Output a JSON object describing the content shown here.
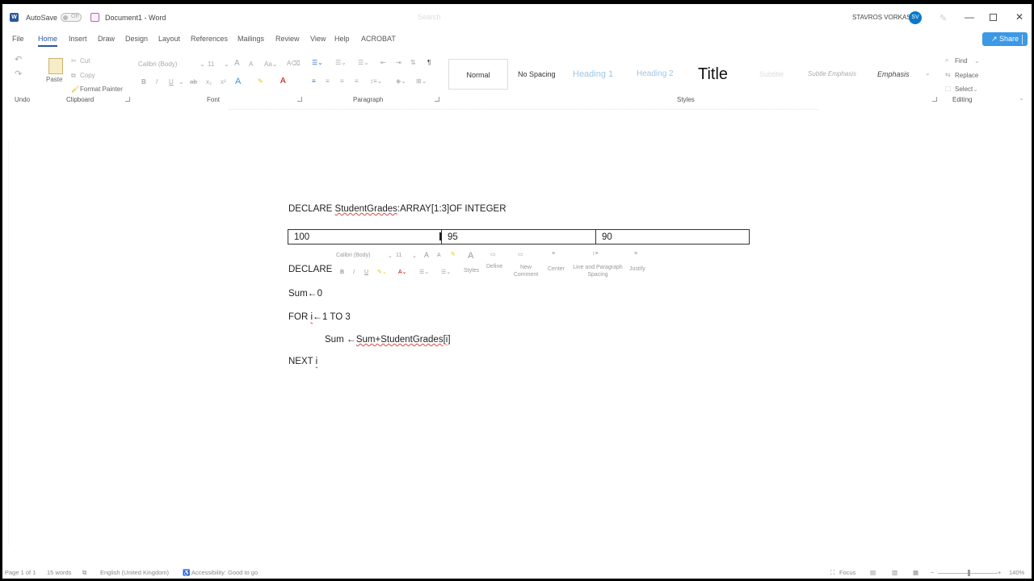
{
  "titlebar": {
    "autosave_label": "AutoSave",
    "autosave_state": "Off",
    "document_title": "Document1 - Word",
    "search_placeholder": "Search",
    "user_name": "STAVROS VORKAS",
    "avatar_initials": "SV"
  },
  "menu": {
    "items": [
      "File",
      "Home",
      "Insert",
      "Draw",
      "Design",
      "Layout",
      "References",
      "Mailings",
      "Review",
      "View",
      "Help",
      "ACROBAT"
    ],
    "active": "Home",
    "share_label": "Share"
  },
  "ribbon": {
    "undo_label": "Undo",
    "clipboard": {
      "paste": "Paste",
      "cut": "Cut",
      "copy": "Copy",
      "format_painter": "Format Painter",
      "group": "Clipboard"
    },
    "font": {
      "name": "Calibri (Body)",
      "size": "11",
      "group": "Font"
    },
    "paragraph_group": "Paragraph",
    "styles": {
      "items": [
        "Normal",
        "No Spacing",
        "Heading 1",
        "Heading 2",
        "Title",
        "Subtitle",
        "Subtle Emphasis",
        "Emphasis"
      ],
      "group": "Styles"
    },
    "editing": {
      "find": "Find",
      "replace": "Replace",
      "select": "Select",
      "group": "Editing"
    }
  },
  "document": {
    "line1_keyword": "DECLARE",
    "line1_identifier": "StudentGrades",
    "line1_rest": ":ARRAY[1:3]OF INTEGER",
    "table_cells": [
      "100",
      "95",
      "90"
    ],
    "line2": "DECLARE",
    "line3_var": "Sum",
    "line3_arrow": "←",
    "line3_value": "0",
    "line4_for": "FOR",
    "line4_i": "i",
    "line4_arrow": "←",
    "line4_rest": "1 TO 3",
    "line5_var": "Sum",
    "line5_arrow": "←",
    "line5_expr": "Sum+StudentGrades[i]",
    "line6_next": "NEXT",
    "line6_i": "i"
  },
  "mini_toolbar": {
    "font": "Calibri (Body)",
    "size": "11",
    "styles": "Styles",
    "define": "Define",
    "new_comment": "New Comment",
    "center": "Center",
    "line_spacing": "Line and Paragraph Spacing",
    "justify": "Justify"
  },
  "status": {
    "page": "Page 1 of 1",
    "words": "15 words",
    "language": "English (United Kingdom)",
    "accessibility": "Accessibility: Good to go",
    "focus": "Focus",
    "zoom": "140%"
  }
}
